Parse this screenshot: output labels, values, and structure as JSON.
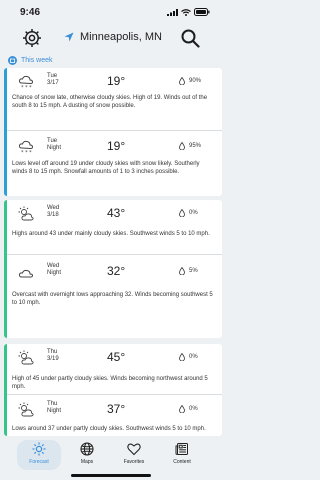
{
  "status_bar": {
    "time": "9:46"
  },
  "header": {
    "location": "Minneapolis, MN"
  },
  "section": {
    "label": "This week"
  },
  "days": [
    {
      "bar_color": "#2b9fd6",
      "periods": [
        {
          "day": "Tue",
          "date": "3/17",
          "temp": "19°",
          "precip": "90%",
          "icon": "snow-cloud-icon",
          "desc": "Chance of snow late, otherwise cloudy skies.  High of 19.  Winds out of the south 8 to 15 mph.  A dusting of snow possible."
        },
        {
          "day": "Tue",
          "date": "Night",
          "temp": "19°",
          "precip": "95%",
          "icon": "snow-cloud-icon",
          "desc": "Lows level off around 19 under cloudy skies with snow likely.  Southerly winds 8 to 15 mph. Snowfall amounts of 1 to 3 inches possible."
        }
      ]
    },
    {
      "bar_color": "#35c48a",
      "periods": [
        {
          "day": "Wed",
          "date": "3/18",
          "temp": "43°",
          "precip": "0%",
          "icon": "partly-cloudy-icon",
          "desc": "Highs around 43 under mainly cloudy skies.  Southwest winds 5 to 10 mph."
        },
        {
          "day": "Wed",
          "date": "Night",
          "temp": "32°",
          "precip": "5%",
          "icon": "cloudy-icon",
          "desc": "Overcast with overnight lows approaching 32.  Winds becoming southwest 5 to 10 mph."
        }
      ]
    },
    {
      "bar_color": "#35c48a",
      "periods": [
        {
          "day": "Thu",
          "date": "3/19",
          "temp": "45°",
          "precip": "0%",
          "icon": "partly-cloudy-icon",
          "desc": "High of 45 under partly cloudy skies.  Winds becoming northwest around 5 mph."
        },
        {
          "day": "Thu",
          "date": "Night",
          "temp": "37°",
          "precip": "0%",
          "icon": "partly-cloudy-icon",
          "desc": "Lows around 37 under partly cloudy skies.  Southwest winds 5 to 10 mph."
        }
      ]
    }
  ],
  "tabs": [
    {
      "label": "Forecast",
      "icon": "sun-icon",
      "active": true
    },
    {
      "label": "Maps",
      "icon": "globe-icon",
      "active": false
    },
    {
      "label": "Favorites",
      "icon": "heart-icon",
      "active": false
    },
    {
      "label": "Content",
      "icon": "newspaper-icon",
      "active": false
    }
  ]
}
